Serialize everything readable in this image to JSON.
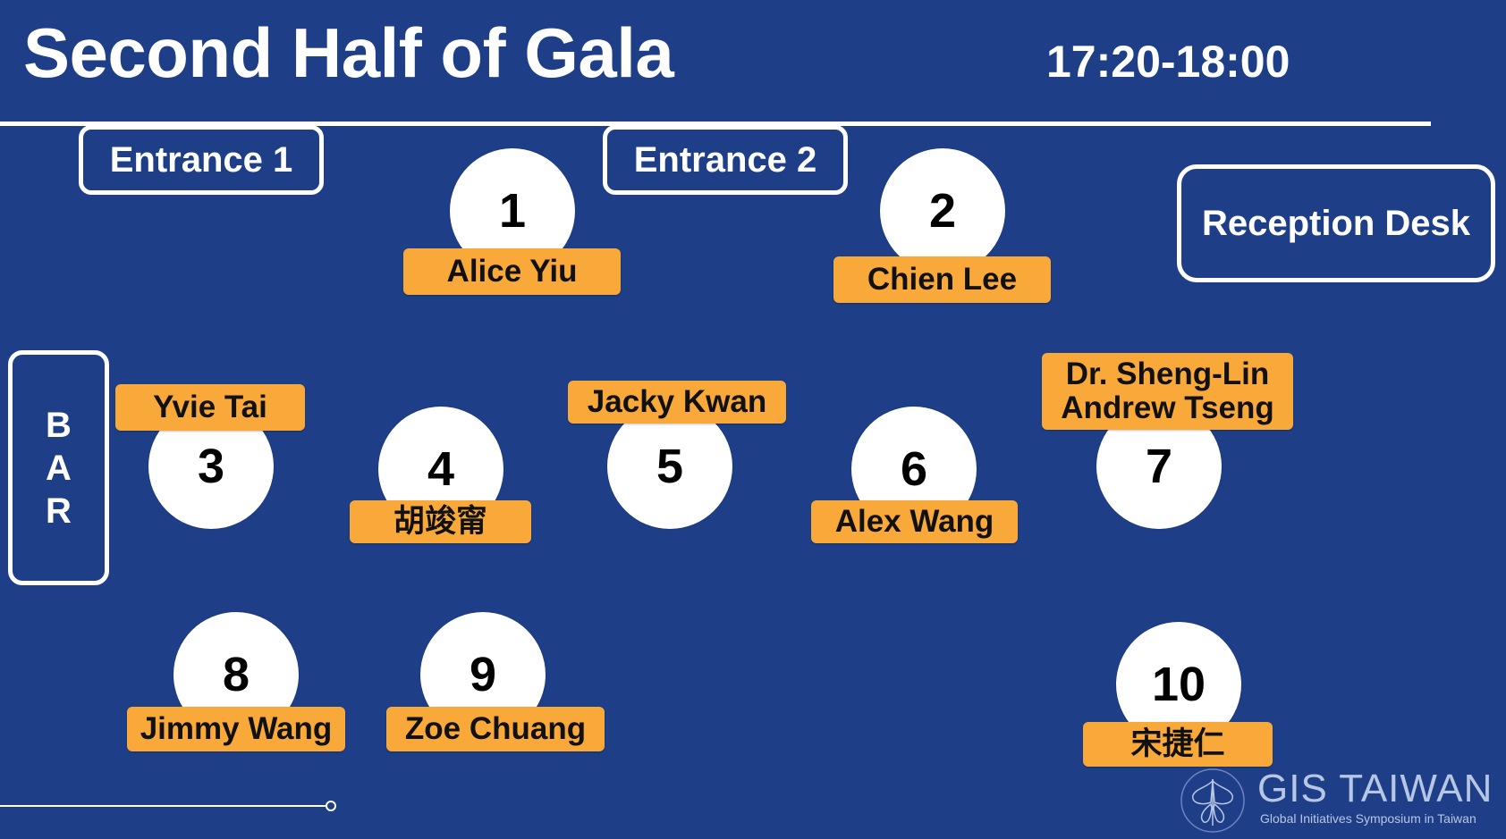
{
  "header": {
    "title": "Second Half of Gala",
    "time_range": "17:20-18:00"
  },
  "landmarks": {
    "entrance_1": "Entrance 1",
    "entrance_2": "Entrance 2",
    "reception": "Reception Desk",
    "bar_letters": [
      "B",
      "A",
      "R"
    ]
  },
  "tables": [
    {
      "number": "1",
      "host": "Alice Yiu"
    },
    {
      "number": "2",
      "host": "Chien Lee"
    },
    {
      "number": "3",
      "host": "Yvie Tai"
    },
    {
      "number": "4",
      "host": "胡竣甯"
    },
    {
      "number": "5",
      "host": "Jacky Kwan"
    },
    {
      "number": "6",
      "host": "Alex Wang"
    },
    {
      "number": "7",
      "host_lines": [
        "Dr. Sheng-Lin",
        "Andrew Tseng"
      ]
    },
    {
      "number": "8",
      "host": "Jimmy Wang"
    },
    {
      "number": "9",
      "host": "Zoe Chuang"
    },
    {
      "number": "10",
      "host": "宋捷仁"
    }
  ],
  "logo": {
    "name": "GIS TAIWAN",
    "tagline": "Global Initiatives Symposium in Taiwan",
    "icon": "butterfly-icon"
  },
  "colors": {
    "background": "#1e3f87",
    "name_tag": "#f9a93a",
    "table": "#ffffff"
  }
}
